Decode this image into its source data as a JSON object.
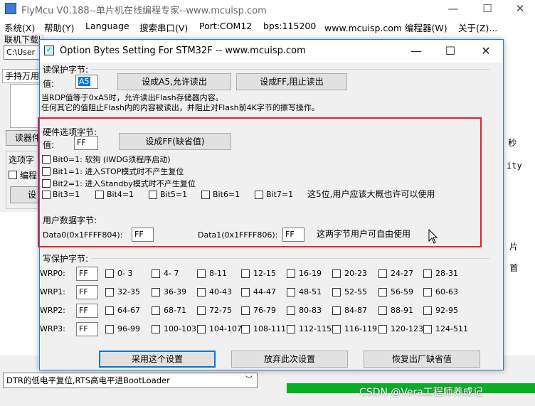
{
  "main_window": {
    "title": "FlyMcu V0.188--单片机在线编程专家--www.mcuisp.com",
    "controls": {
      "minimize": "—",
      "maximize": "☐",
      "close": "✕"
    },
    "menu": [
      {
        "label": "系统(X)"
      },
      {
        "label": "帮助(Y)"
      },
      {
        "label": "Language"
      },
      {
        "label": "搜索串口(V)"
      },
      {
        "label": "Port:COM12"
      },
      {
        "label": "bps:115200"
      },
      {
        "label": "www.mcuisp.com 编程器(W)"
      },
      {
        "label": "关于(Z)..."
      }
    ],
    "file_label": "联机下载时的程序文件：",
    "file_path": "C:\\User",
    "tab_label": "手持万用",
    "read_button": "读器件",
    "options_label": "选项字",
    "edit_checkbox_label": "编程",
    "set_button": "设",
    "right_fragments": [
      "秒",
      "ity",
      "片",
      "首"
    ],
    "status_combo": "DTR的低电平复位,RTS高电平进BootLoader",
    "progress": 1.0,
    "progress_color": "#06b025"
  },
  "dialog": {
    "title": "Option Bytes Setting For STM32F -- www.mcuisp.com",
    "icon": "check-icon",
    "controls": {
      "minimize": "—",
      "maximize": "☐",
      "close": "✕"
    },
    "read_protect": {
      "group_label": "读保护字节:",
      "value_label": "值:",
      "value": "A5",
      "btn_allow": "设成A5,允许读出",
      "btn_block": "设成FF,阻止读出",
      "note1": "当RDP值等于0xA5时，允许读出Flash存储器内容。",
      "note2": "任何其它的值阻止Flash内的内容被读出，并阻止对Flash前4K字节的擦写操作。"
    },
    "hardware": {
      "group_label": "硬件选项字节:",
      "value_label": "值:",
      "value": "FF",
      "btn_default": "设成FF(缺省值)",
      "bits": [
        {
          "label": "Bit0=1: 软狗 (IWDG须程序启动)",
          "checked": false
        },
        {
          "label": "Bit1=1: 进入STOP模式时不产生复位",
          "checked": false
        },
        {
          "label": "Bit2=1: 进入Standby模式时不产生复位",
          "checked": false
        }
      ],
      "extra_bits": [
        {
          "label": "Bit3=1",
          "checked": false
        },
        {
          "label": "Bit4=1",
          "checked": false
        },
        {
          "label": "Bit5=1",
          "checked": false
        },
        {
          "label": "Bit6=1",
          "checked": false
        },
        {
          "label": "Bit7=1",
          "checked": false
        }
      ],
      "note": "这5位,用户应该大概也许可以使用"
    },
    "user_data": {
      "group_label": "用户数据字节:",
      "data0_label": "Data0(0x1FFFF804):",
      "data0_value": "FF",
      "data1_label": "Data1(0x1FFFF806):",
      "data1_value": "FF",
      "note": "这两字节用户可自由使用"
    },
    "write_protect": {
      "group_label": "写保护字节:",
      "rows": [
        {
          "label": "WRP0:",
          "value": "FF",
          "ranges": [
            "0- 3",
            "4- 7",
            "8-11",
            "12-15",
            "16-19",
            "20-23",
            "24-27",
            "28-31"
          ]
        },
        {
          "label": "WRP1:",
          "value": "FF",
          "ranges": [
            "32-35",
            "36-39",
            "40-43",
            "44-47",
            "48-51",
            "52-55",
            "56-59",
            "60-63"
          ]
        },
        {
          "label": "WRP2:",
          "value": "FF",
          "ranges": [
            "64-67",
            "68-71",
            "72-75",
            "76-79",
            "80-83",
            "84-87",
            "88-91",
            "92-95"
          ]
        },
        {
          "label": "WRP3:",
          "value": "FF",
          "ranges": [
            "96-99",
            "100-103",
            "104-107",
            "108-111",
            "112-115",
            "116-119",
            "120-123",
            "124-511"
          ]
        }
      ]
    },
    "buttons": {
      "apply": "采用这个设置",
      "discard": "放弃此次设置",
      "restore": "恢复出厂缺省值"
    },
    "highlight_color": "#e8202a"
  },
  "watermark": "CSDN @Vera工程师养成记"
}
